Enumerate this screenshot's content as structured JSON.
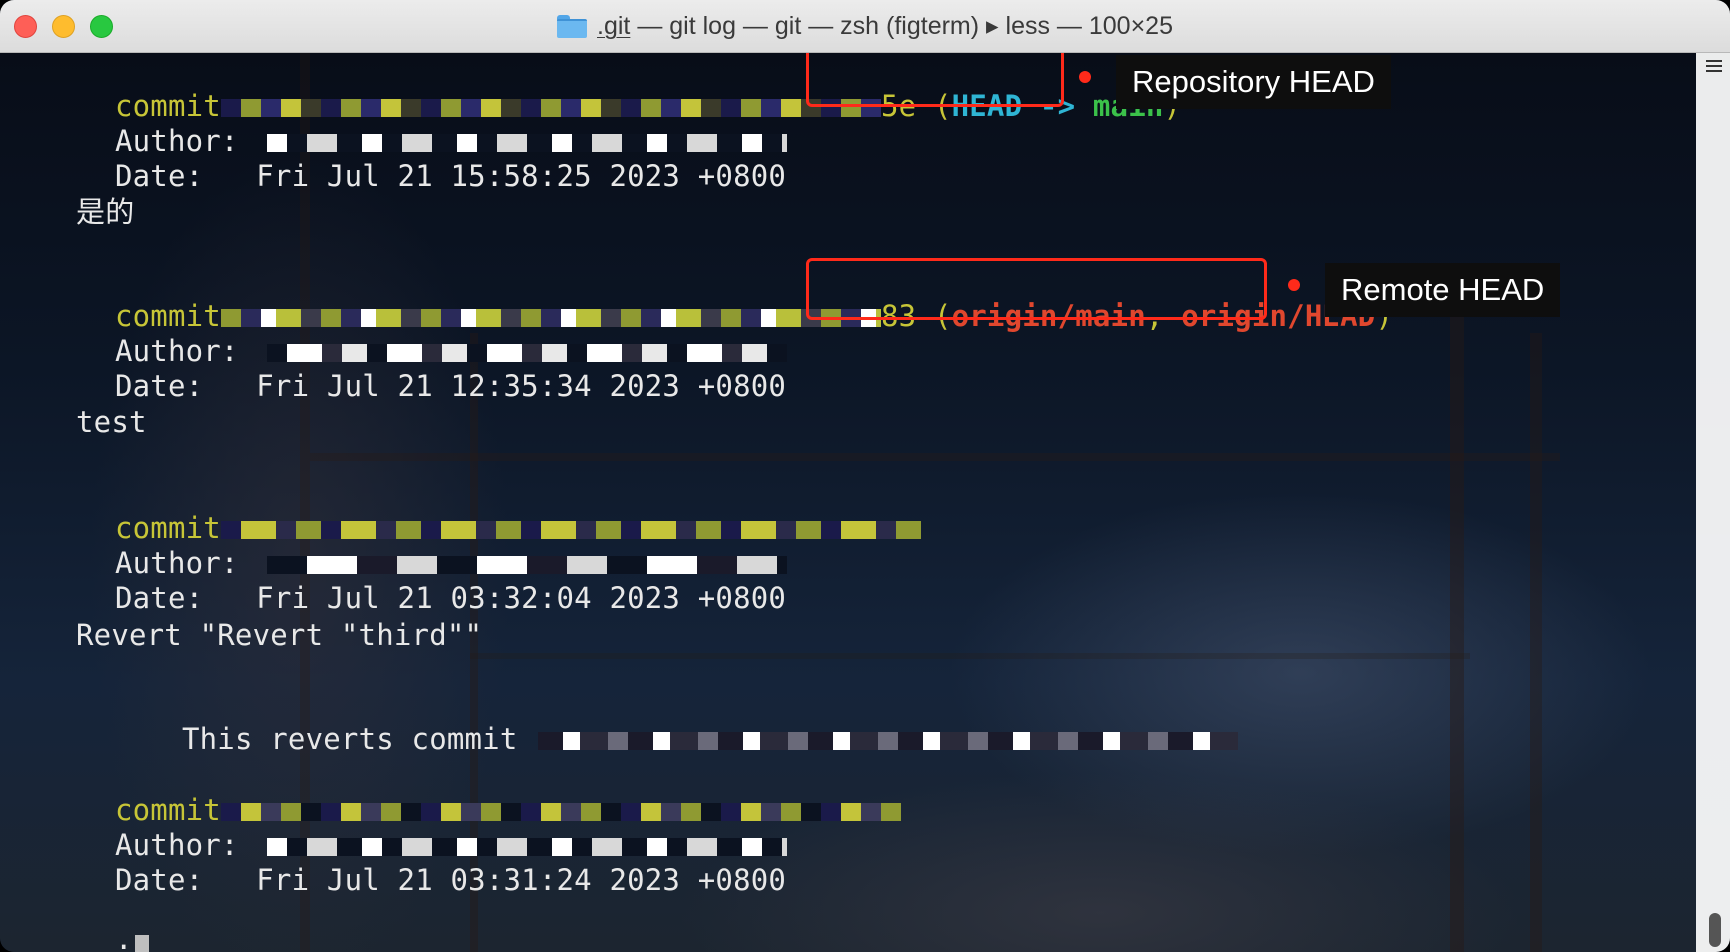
{
  "window": {
    "title_dirname": ".git",
    "title_rest": " — git log — git — zsh (figterm) ▸ less — 100×25"
  },
  "log": {
    "entries": [
      {
        "commit_label": "commit",
        "hash_suffix": "5e",
        "refs_open": "(",
        "ref_head": "HEAD",
        "ref_arrow": " -> ",
        "ref_branch": "main",
        "refs_close": ")",
        "author_label": "Author:",
        "date_label": "Date:",
        "date": "Fri Jul 21 15:58:25 2023 +0800",
        "message": "是的"
      },
      {
        "commit_label": "commit",
        "hash_suffix": "83",
        "refs_open": "(",
        "ref_origin_main": "origin/main",
        "ref_sep": ", ",
        "ref_origin_head": "origin/HEAD",
        "refs_close": ")",
        "author_label": "Author:",
        "date_label": "Date:",
        "date": "Fri Jul 21 12:35:34 2023 +0800",
        "message": "test"
      },
      {
        "commit_label": "commit",
        "author_label": "Author:",
        "date_label": "Date:",
        "date": "Fri Jul 21 03:32:04 2023 +0800",
        "message": "Revert \"Revert \"third\"\"",
        "message_line2": "This reverts commit"
      },
      {
        "commit_label": "commit",
        "author_label": "Author:",
        "date_label": "Date:",
        "date": "Fri Jul 21 03:31:24 2023 +0800"
      }
    ],
    "prompt": ":"
  },
  "annotations": {
    "repository_head": "Repository HEAD",
    "remote_head": "Remote HEAD",
    "color": "#ff2a1a"
  }
}
